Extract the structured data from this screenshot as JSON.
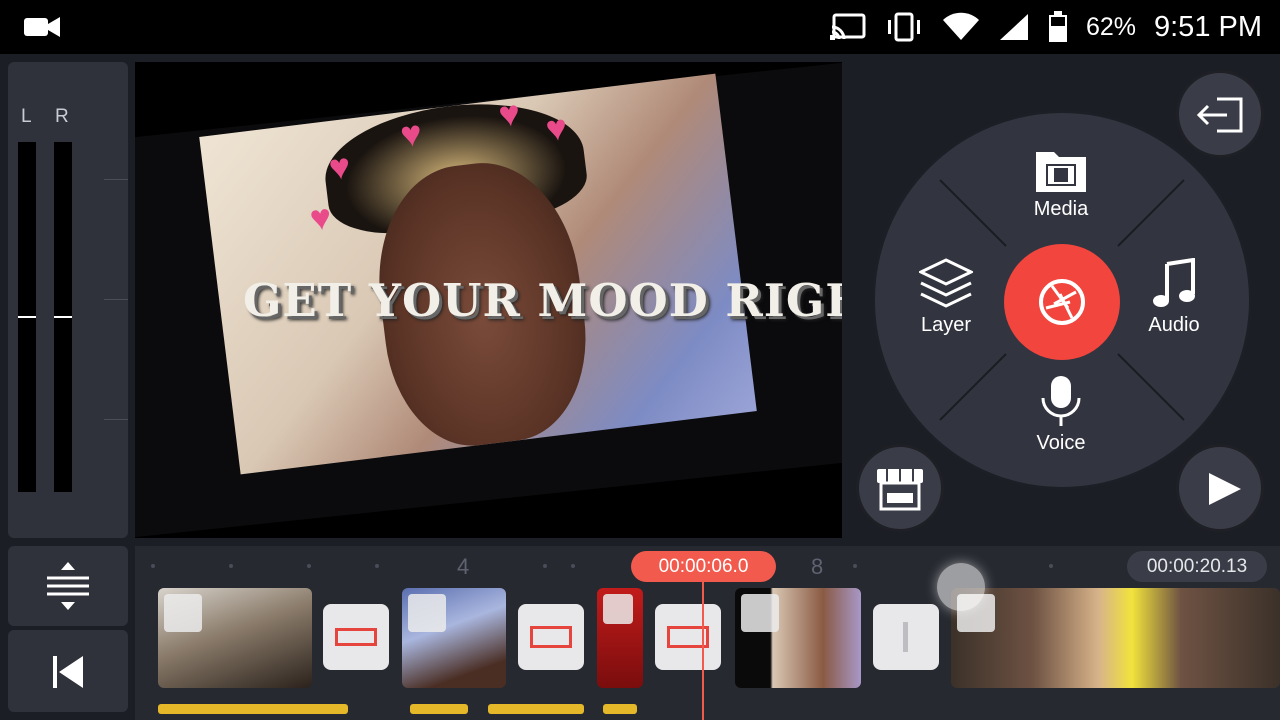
{
  "status_bar": {
    "battery_percent": "62%",
    "time": "9:51 PM",
    "icons": [
      "video-camera-icon",
      "cast-icon",
      "vibrate-icon",
      "wifi-icon",
      "signal-icon",
      "battery-icon"
    ]
  },
  "meter": {
    "left_label": "L",
    "right_label": "R"
  },
  "preview": {
    "overlay_text": "GET YOUR MOOD RIGHT"
  },
  "menu": {
    "media_label": "Media",
    "layer_label": "Layer",
    "audio_label": "Audio",
    "voice_label": "Voice",
    "record_icon": "camera-shutter-icon",
    "exit_icon": "exit-icon",
    "store_icon": "store-icon",
    "play_icon": "play-icon"
  },
  "timeline": {
    "current_time": "00:00:06.0",
    "total_duration": "00:00:20.13",
    "ruler_marks": [
      "4",
      "8"
    ]
  },
  "colors": {
    "accent_red": "#f1453d",
    "audio_track_yellow": "#e5b82a",
    "panel_bg": "#2f323b"
  }
}
